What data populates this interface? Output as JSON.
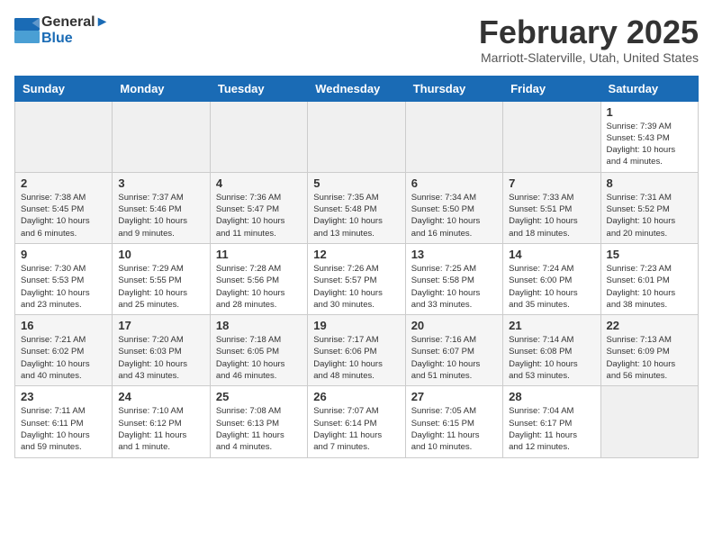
{
  "header": {
    "logo_line1": "General",
    "logo_line2": "Blue",
    "month_title": "February 2025",
    "location": "Marriott-Slaterville, Utah, United States"
  },
  "weekdays": [
    "Sunday",
    "Monday",
    "Tuesday",
    "Wednesday",
    "Thursday",
    "Friday",
    "Saturday"
  ],
  "weeks": [
    [
      {
        "day": "",
        "info": ""
      },
      {
        "day": "",
        "info": ""
      },
      {
        "day": "",
        "info": ""
      },
      {
        "day": "",
        "info": ""
      },
      {
        "day": "",
        "info": ""
      },
      {
        "day": "",
        "info": ""
      },
      {
        "day": "1",
        "info": "Sunrise: 7:39 AM\nSunset: 5:43 PM\nDaylight: 10 hours\nand 4 minutes."
      }
    ],
    [
      {
        "day": "2",
        "info": "Sunrise: 7:38 AM\nSunset: 5:45 PM\nDaylight: 10 hours\nand 6 minutes."
      },
      {
        "day": "3",
        "info": "Sunrise: 7:37 AM\nSunset: 5:46 PM\nDaylight: 10 hours\nand 9 minutes."
      },
      {
        "day": "4",
        "info": "Sunrise: 7:36 AM\nSunset: 5:47 PM\nDaylight: 10 hours\nand 11 minutes."
      },
      {
        "day": "5",
        "info": "Sunrise: 7:35 AM\nSunset: 5:48 PM\nDaylight: 10 hours\nand 13 minutes."
      },
      {
        "day": "6",
        "info": "Sunrise: 7:34 AM\nSunset: 5:50 PM\nDaylight: 10 hours\nand 16 minutes."
      },
      {
        "day": "7",
        "info": "Sunrise: 7:33 AM\nSunset: 5:51 PM\nDaylight: 10 hours\nand 18 minutes."
      },
      {
        "day": "8",
        "info": "Sunrise: 7:31 AM\nSunset: 5:52 PM\nDaylight: 10 hours\nand 20 minutes."
      }
    ],
    [
      {
        "day": "9",
        "info": "Sunrise: 7:30 AM\nSunset: 5:53 PM\nDaylight: 10 hours\nand 23 minutes."
      },
      {
        "day": "10",
        "info": "Sunrise: 7:29 AM\nSunset: 5:55 PM\nDaylight: 10 hours\nand 25 minutes."
      },
      {
        "day": "11",
        "info": "Sunrise: 7:28 AM\nSunset: 5:56 PM\nDaylight: 10 hours\nand 28 minutes."
      },
      {
        "day": "12",
        "info": "Sunrise: 7:26 AM\nSunset: 5:57 PM\nDaylight: 10 hours\nand 30 minutes."
      },
      {
        "day": "13",
        "info": "Sunrise: 7:25 AM\nSunset: 5:58 PM\nDaylight: 10 hours\nand 33 minutes."
      },
      {
        "day": "14",
        "info": "Sunrise: 7:24 AM\nSunset: 6:00 PM\nDaylight: 10 hours\nand 35 minutes."
      },
      {
        "day": "15",
        "info": "Sunrise: 7:23 AM\nSunset: 6:01 PM\nDaylight: 10 hours\nand 38 minutes."
      }
    ],
    [
      {
        "day": "16",
        "info": "Sunrise: 7:21 AM\nSunset: 6:02 PM\nDaylight: 10 hours\nand 40 minutes."
      },
      {
        "day": "17",
        "info": "Sunrise: 7:20 AM\nSunset: 6:03 PM\nDaylight: 10 hours\nand 43 minutes."
      },
      {
        "day": "18",
        "info": "Sunrise: 7:18 AM\nSunset: 6:05 PM\nDaylight: 10 hours\nand 46 minutes."
      },
      {
        "day": "19",
        "info": "Sunrise: 7:17 AM\nSunset: 6:06 PM\nDaylight: 10 hours\nand 48 minutes."
      },
      {
        "day": "20",
        "info": "Sunrise: 7:16 AM\nSunset: 6:07 PM\nDaylight: 10 hours\nand 51 minutes."
      },
      {
        "day": "21",
        "info": "Sunrise: 7:14 AM\nSunset: 6:08 PM\nDaylight: 10 hours\nand 53 minutes."
      },
      {
        "day": "22",
        "info": "Sunrise: 7:13 AM\nSunset: 6:09 PM\nDaylight: 10 hours\nand 56 minutes."
      }
    ],
    [
      {
        "day": "23",
        "info": "Sunrise: 7:11 AM\nSunset: 6:11 PM\nDaylight: 10 hours\nand 59 minutes."
      },
      {
        "day": "24",
        "info": "Sunrise: 7:10 AM\nSunset: 6:12 PM\nDaylight: 11 hours\nand 1 minute."
      },
      {
        "day": "25",
        "info": "Sunrise: 7:08 AM\nSunset: 6:13 PM\nDaylight: 11 hours\nand 4 minutes."
      },
      {
        "day": "26",
        "info": "Sunrise: 7:07 AM\nSunset: 6:14 PM\nDaylight: 11 hours\nand 7 minutes."
      },
      {
        "day": "27",
        "info": "Sunrise: 7:05 AM\nSunset: 6:15 PM\nDaylight: 11 hours\nand 10 minutes."
      },
      {
        "day": "28",
        "info": "Sunrise: 7:04 AM\nSunset: 6:17 PM\nDaylight: 11 hours\nand 12 minutes."
      },
      {
        "day": "",
        "info": ""
      }
    ]
  ]
}
